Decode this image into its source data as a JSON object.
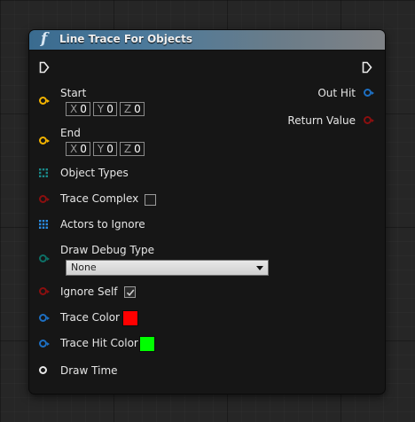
{
  "node": {
    "title": "Line Trace For Objects",
    "icon": "function-icon"
  },
  "inputs": {
    "start": {
      "label": "Start",
      "x": "0",
      "y": "0",
      "z": "0"
    },
    "end": {
      "label": "End",
      "x": "0",
      "y": "0",
      "z": "0"
    },
    "object_types": {
      "label": "Object Types"
    },
    "trace_complex": {
      "label": "Trace Complex",
      "checked": false
    },
    "actors_to_ignore": {
      "label": "Actors to Ignore"
    },
    "draw_debug_type": {
      "label": "Draw Debug Type",
      "value": "None"
    },
    "ignore_self": {
      "label": "Ignore Self",
      "checked": true
    },
    "trace_color": {
      "label": "Trace Color",
      "color": "#ff0000"
    },
    "trace_hit_color": {
      "label": "Trace Hit Color",
      "color": "#00ff00"
    },
    "draw_time": {
      "label": "Draw Time"
    }
  },
  "axis_labels": {
    "x": "X",
    "y": "Y",
    "z": "Z"
  },
  "outputs": {
    "out_hit": {
      "label": "Out Hit"
    },
    "return_value": {
      "label": "Return Value"
    }
  },
  "colors": {
    "vector_pin": "#f4b400",
    "bool_pin": "#8b0f0f",
    "struct_pin": "#1d6fc2",
    "enum_pin": "#0d6f66",
    "float_pin": "#e8e8e8",
    "array_pin_teal": "#1a8a8a",
    "array_pin_blue": "#2a8be0"
  }
}
